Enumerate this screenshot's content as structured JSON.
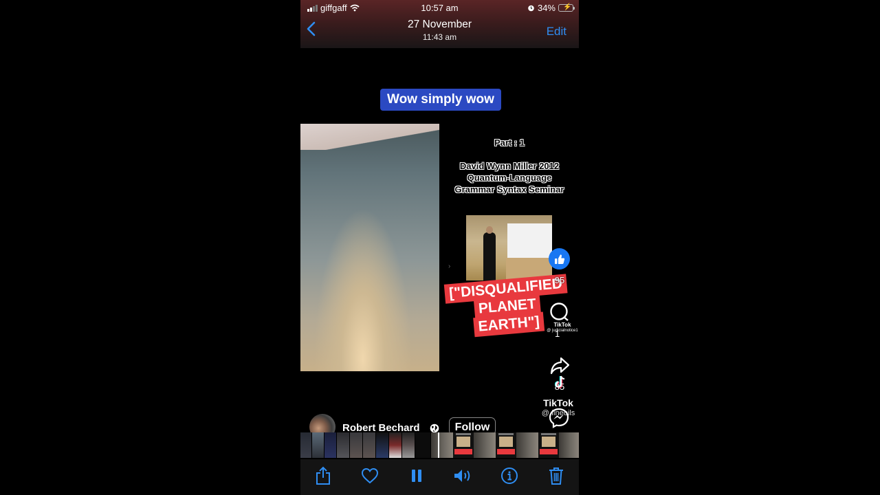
{
  "status_bar": {
    "carrier": "giffgaff",
    "time": "10:57 am",
    "battery_percent": "34%",
    "battery_level": 0.34,
    "charging": true,
    "alarm": true
  },
  "nav": {
    "back_icon": "chevron-left-icon",
    "title": "27 November",
    "subtitle": "11:43 am",
    "edit_label": "Edit"
  },
  "video": {
    "caption": "Wow simply wow",
    "part_label": "Part : 1",
    "seminar_title_lines": [
      "David Wynn Miller 2012",
      "Quantum-Language",
      "Grammar Syntax Seminar"
    ],
    "sticker_lines": [
      "[\"DISQUALIFIED",
      "PLANET",
      "EARTH\"]"
    ],
    "like_count": "95",
    "comment_count": "1",
    "share_count": "85",
    "tiktok_small_brand": "TikTok",
    "tiktok_small_handle": "@ judicialnotice1",
    "tiktok_brand": "TikTok",
    "tiktok_handle": "@ fineoils",
    "colors": {
      "caption_bg": "#2b49c2",
      "sticker_bg": "#e8393e",
      "like_blue": "#1877f2"
    }
  },
  "profile": {
    "name": "Robert Bechard",
    "follow_label": "Follow"
  },
  "toolbar": {
    "items": [
      {
        "name": "share",
        "icon": "share-icon"
      },
      {
        "name": "favorite",
        "icon": "heart-icon"
      },
      {
        "name": "pause",
        "icon": "pause-icon"
      },
      {
        "name": "volume",
        "icon": "speaker-icon"
      },
      {
        "name": "info",
        "icon": "info-icon"
      },
      {
        "name": "delete",
        "icon": "trash-icon"
      }
    ],
    "accent": "#2f8ef3"
  }
}
